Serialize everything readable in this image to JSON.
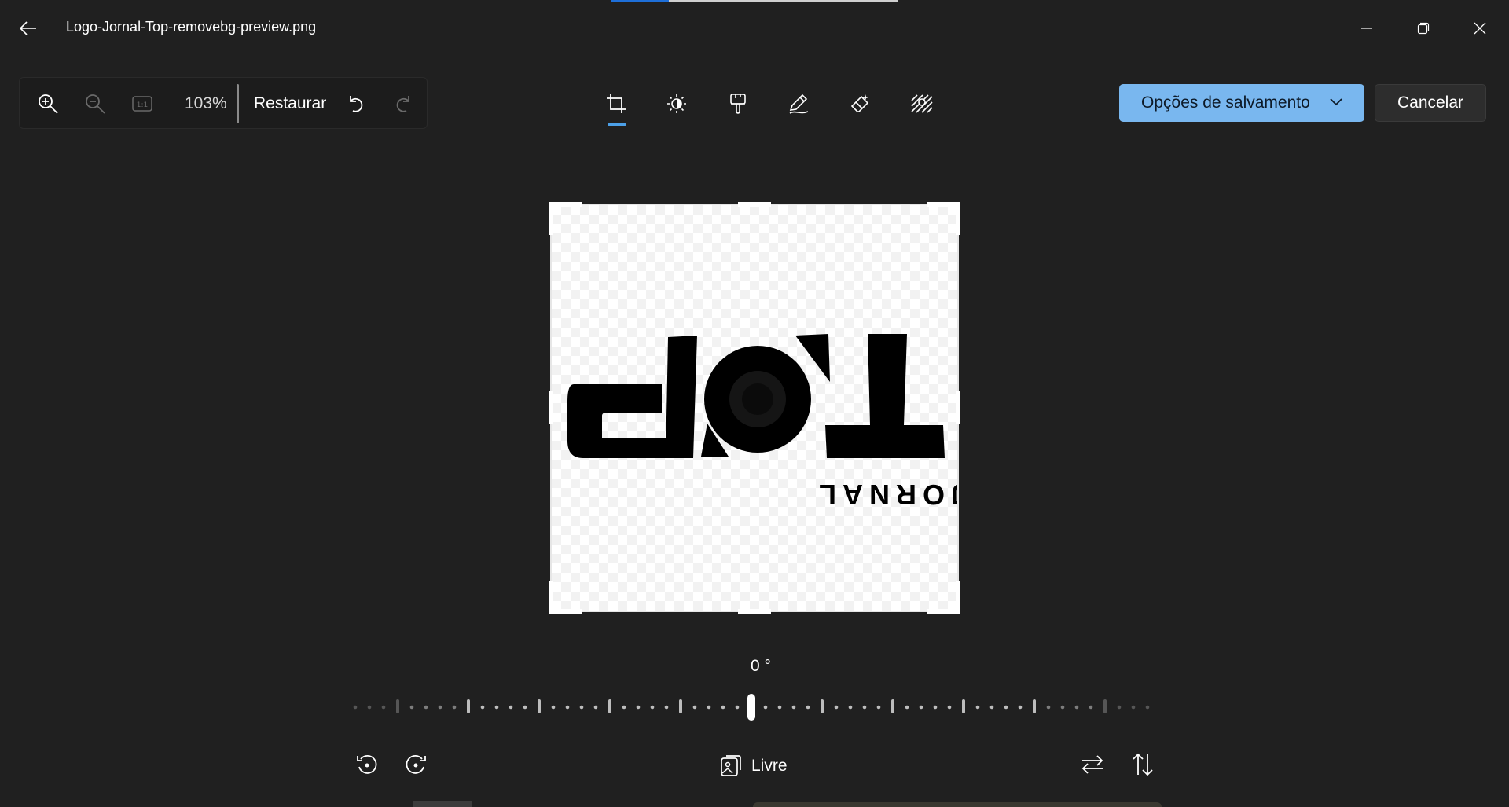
{
  "window": {
    "title": "Logo-Jornal-Top-removebg-preview.png"
  },
  "toolbar": {
    "zoom_level": "103%",
    "restore_label": "Restaurar"
  },
  "tools": [
    {
      "name": "crop",
      "active": true
    },
    {
      "name": "adjust"
    },
    {
      "name": "filter"
    },
    {
      "name": "markup"
    },
    {
      "name": "erase"
    },
    {
      "name": "background"
    }
  ],
  "actions": {
    "save_label": "Opções de salvamento",
    "cancel_label": "Cancelar"
  },
  "image": {
    "logo_text_main": "TOP",
    "logo_text_sub": "JORNAL",
    "orientation": "rotated 180°"
  },
  "crop": {
    "angle": "0 °",
    "aspect_label": "Livre"
  },
  "colors": {
    "background": "#202020",
    "accent": "#79b7ef",
    "active_indicator": "#4ca0e8"
  }
}
